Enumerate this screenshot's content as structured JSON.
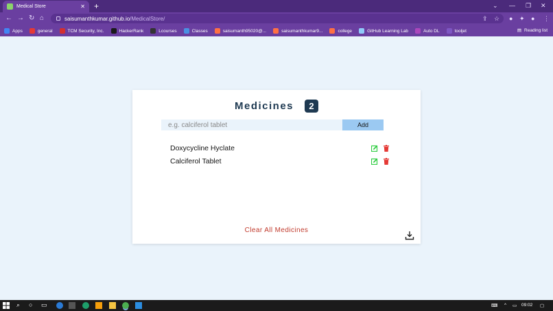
{
  "browser": {
    "tab_title": "Medical Store",
    "url_host": "saisumanthkumar.github.io",
    "url_path": "/MedicalStore/",
    "bookmarks": [
      {
        "label": "Apps",
        "color": "#4285f4"
      },
      {
        "label": "general",
        "color": "#e53935"
      },
      {
        "label": "TCM Security, Inc.",
        "color": "#d32f2f"
      },
      {
        "label": "HackerRank",
        "color": "#1a1a1a"
      },
      {
        "label": "Lcourses",
        "color": "#333333"
      },
      {
        "label": "Classes",
        "color": "#4a90e2"
      },
      {
        "label": "saisumanth95020@...",
        "color": "#ff7043"
      },
      {
        "label": "saisumanthkumar9...",
        "color": "#ff7043"
      },
      {
        "label": "college",
        "color": "#ff7043"
      },
      {
        "label": "GitHub Learning Lab",
        "color": "#90caf9"
      },
      {
        "label": "Auto DL",
        "color": "#ab47bc"
      },
      {
        "label": "tooljet",
        "color": "#7e57c2"
      }
    ],
    "reading_list": "Reading list"
  },
  "app": {
    "title": "Medicines",
    "count": "2",
    "input_placeholder": "e.g. calciferol tablet",
    "add_label": "Add",
    "medicines": [
      {
        "name": "Doxycycline Hyclate"
      },
      {
        "name": "Calciferol Tablet"
      }
    ],
    "clear_label": "Clear All Medicines"
  },
  "taskbar": {
    "time": "09:02"
  },
  "colors": {
    "background": "#eaf3fb",
    "heading": "#1f3a52",
    "add_button": "#9bc9f2",
    "edit_icon": "#2ecc40",
    "delete_icon": "#e53935",
    "clear_text": "#c0392b",
    "browser_chrome": "#6a3fa0"
  }
}
